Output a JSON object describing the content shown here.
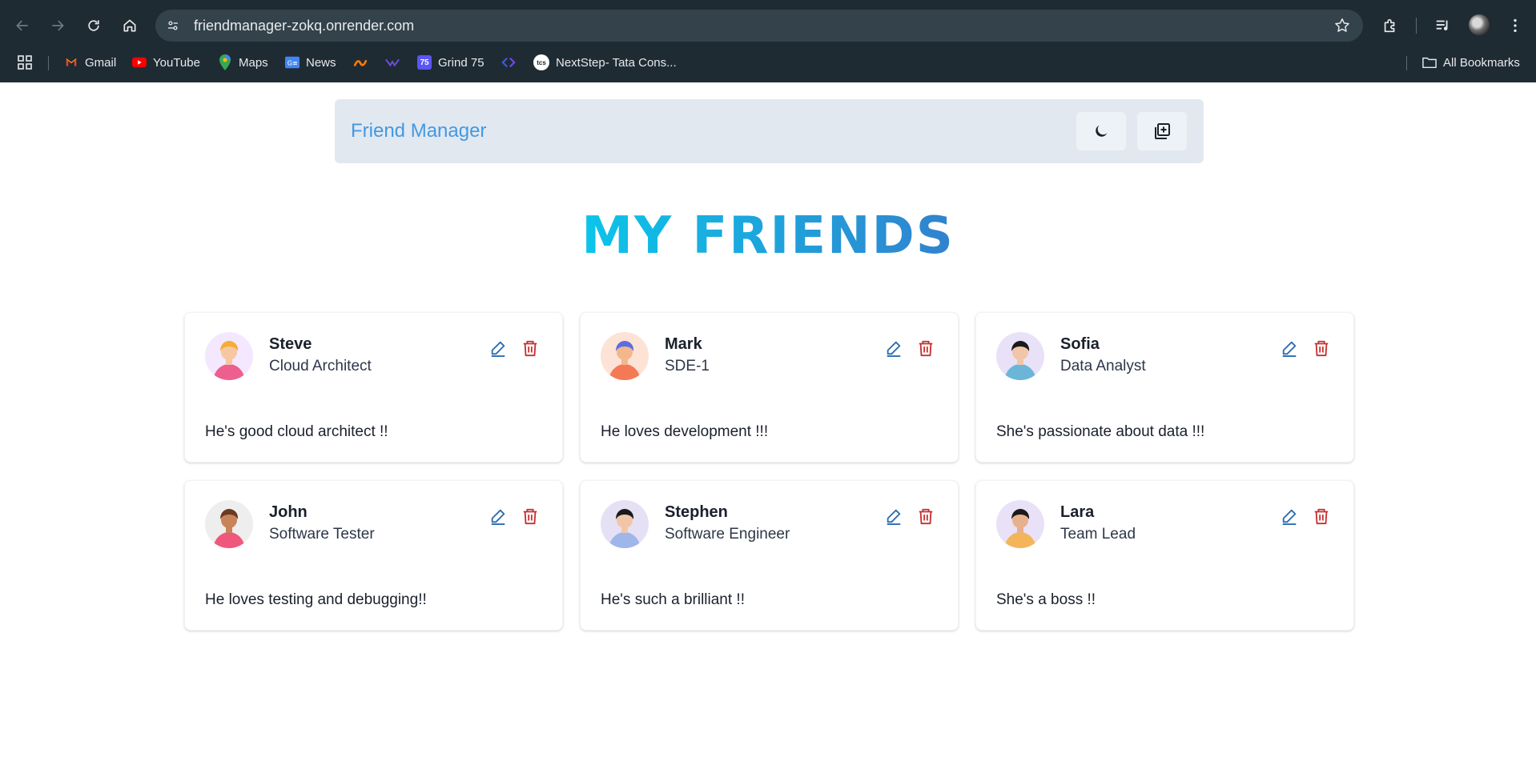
{
  "browser": {
    "url": "friendmanager-zokq.onrender.com",
    "bookmarks": [
      {
        "label": "Gmail",
        "icon": "gmail-icon"
      },
      {
        "label": "YouTube",
        "icon": "youtube-icon"
      },
      {
        "label": "Maps",
        "icon": "maps-icon"
      },
      {
        "label": "News",
        "icon": "news-icon"
      },
      {
        "label": "",
        "icon": "codeforces-icon"
      },
      {
        "label": "",
        "icon": "leetcode-icon"
      },
      {
        "label": "Grind 75",
        "icon": "grind75-icon"
      },
      {
        "label": "",
        "icon": "code-icon"
      },
      {
        "label": "NextStep- Tata Cons...",
        "icon": "tcs-icon"
      }
    ],
    "all_bookmarks": "All Bookmarks",
    "grind_badge": "75",
    "tcs_badge": "tcs"
  },
  "app": {
    "brand": "Friend Manager",
    "heading": "MY FRIENDS",
    "colors": {
      "brand": "#4299e1",
      "nav_bg": "#e2e8f0",
      "edit": "#2b6cb0",
      "delete": "#c53030",
      "heading_from": "#0bc5ea",
      "heading_to": "#3182ce"
    },
    "friends": [
      {
        "name": "Steve",
        "role": "Cloud Architect",
        "description": "He's good cloud architect !!"
      },
      {
        "name": "Mark",
        "role": "SDE-1",
        "description": "He loves development !!!"
      },
      {
        "name": "Sofia",
        "role": "Data Analyst",
        "description": "She's passionate about data !!!"
      },
      {
        "name": "John",
        "role": "Software Tester",
        "description": "He loves testing and debugging!!"
      },
      {
        "name": "Stephen",
        "role": "Software Engineer",
        "description": "He's such a brilliant !!"
      },
      {
        "name": "Lara",
        "role": "Team Lead",
        "description": "She's a boss !!"
      }
    ]
  }
}
